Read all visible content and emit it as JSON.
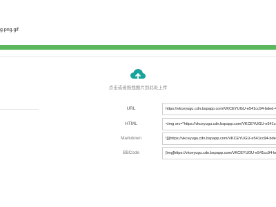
{
  "upload": {
    "file_types": "g.png.gif",
    "progress_percent": 100,
    "progress_color": "#5cb85c",
    "icon": "cloud-upload-icon",
    "icon_color": "#1aa39a",
    "hint": "点击或者拖拽图片到此处上传"
  },
  "links": [
    {
      "label": "URL",
      "value": "https://vkceyugu.cdn.bspapp.com/VKCEYUGU-e541cc94-bded-4a"
    },
    {
      "label": "HTML",
      "value": "<img src=\"https://vkceyugu.cdn.bspapp.com/VKCEYUGU-e541cc94-bd"
    },
    {
      "label": "Markdown",
      "value": "![](https://vkceyugu.cdn.bspapp.com/VKCEYUGU-e541cc94-bded-"
    },
    {
      "label": "BBCode",
      "value": "[img]https://vkceyugu.cdn.bspapp.com/VKCEYUGU-e541cc94-bded-"
    }
  ]
}
